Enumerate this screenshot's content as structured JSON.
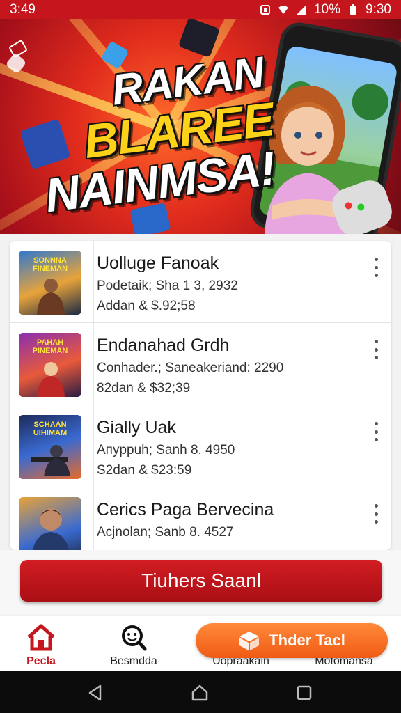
{
  "status_bar": {
    "time": "3:49",
    "battery": "10%",
    "clock_right": "9:30"
  },
  "banner": {
    "headline_line1": "RAKAN",
    "headline_line2": "BLAREE",
    "headline_line3": "NAINMSA!"
  },
  "list": {
    "items": [
      {
        "title": "Uolluge Fanoak",
        "line2": "Podetaik; Sha 1 3, 2932",
        "line3": "Addan &  $.92;58",
        "thumb_text": "SONNNA FINEMAN",
        "thumb_icon": "warrior-art-icon"
      },
      {
        "title": "Endanahad Grdh",
        "line2": "Conhader.; Saneakeriand: 2290",
        "line3": "82dan &  $32;39",
        "thumb_text": "PAHAH PINEMAN",
        "thumb_icon": "hero-art-icon"
      },
      {
        "title": "Gially Uak",
        "line2": "Aпyppuh; Sanh 8. 4950",
        "line3": "S2dan &  $23:59",
        "thumb_text": "SCHAAN UIHIMAM",
        "thumb_icon": "soldier-art-icon"
      },
      {
        "title": "Cerics Paga Bervecina",
        "line2": "Acjnolan; Sanb 8. 4527",
        "line3": "",
        "thumb_text": "",
        "thumb_icon": "portrait-art-icon"
      }
    ]
  },
  "cta": {
    "label": "Tiuhers Saanl"
  },
  "nav": {
    "home_label": "Pecla",
    "search_label": "Besmdda",
    "third_label": "Uopraakain",
    "fourth_label": "Mofomansa",
    "pill_label": "Thder Tacl"
  },
  "colors": {
    "brand_red": "#c4161c",
    "accent_orange": "#f05a14",
    "headline_yellow": "#ffd21a"
  }
}
